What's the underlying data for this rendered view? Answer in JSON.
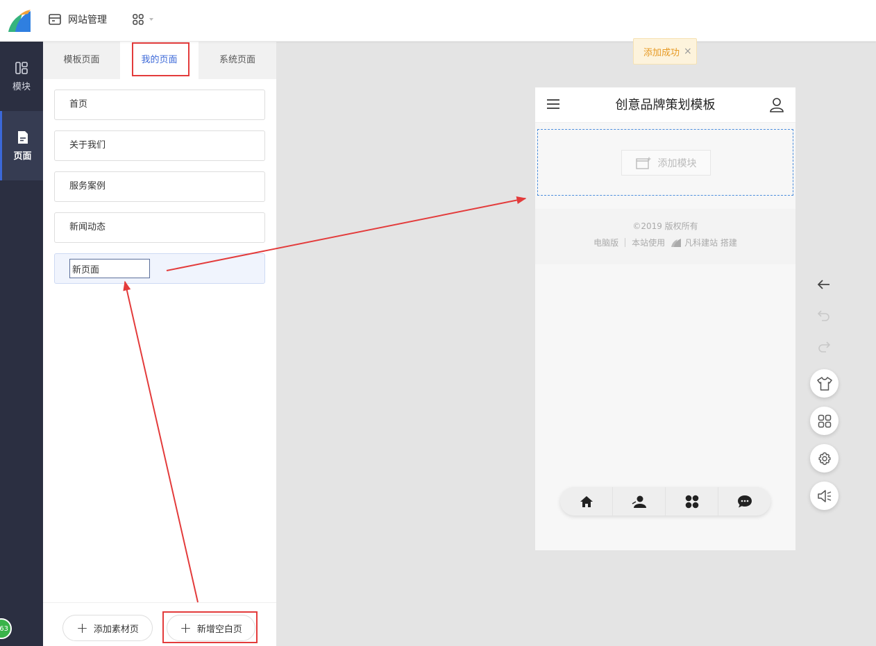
{
  "topbar": {
    "site_management": "网站管理"
  },
  "rail": {
    "modules_label": "模块",
    "pages_label": "页面",
    "badge_text": "63"
  },
  "panel": {
    "tabs": [
      {
        "label": "模板页面"
      },
      {
        "label": "我的页面"
      },
      {
        "label": "系统页面"
      }
    ],
    "pages": [
      {
        "label": "首页"
      },
      {
        "label": "关于我们"
      },
      {
        "label": "服务案例"
      },
      {
        "label": "新闻动态"
      }
    ],
    "new_page_value": "新页面",
    "add_material_page": "添加素材页",
    "add_blank_page": "新增空白页"
  },
  "toast": {
    "text": "添加成功",
    "close": "×"
  },
  "phone": {
    "title": "创意品牌策划模板",
    "add_module": "添加模块",
    "copyright": "©2019 版权所有",
    "footer_desktop": "电脑版",
    "footer_powered": "本站使用",
    "footer_brand": "凡科建站 搭建"
  },
  "colors": {
    "accent": "#3b68d8",
    "highlight_red": "#e33b3b",
    "toast_text": "#e69a24",
    "rail_bg": "#2b2f41"
  }
}
